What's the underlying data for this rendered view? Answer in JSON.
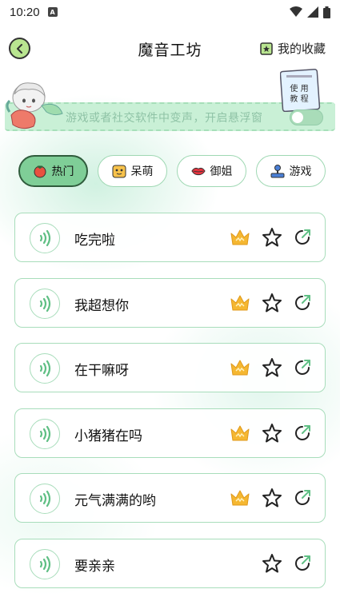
{
  "status": {
    "time": "10:20"
  },
  "header": {
    "title": "魔音工坊",
    "favorites_label": "我的收藏"
  },
  "banner": {
    "text": "游戏或者社交软件中变声，开启悬浮窗",
    "guide_label_line1": "使 用",
    "guide_label_line2": "教 程",
    "toggle_on": false
  },
  "tabs": [
    {
      "label": "热门",
      "icon": "tomato-icon",
      "active": true
    },
    {
      "label": "呆萌",
      "icon": "cute-face-icon",
      "active": false
    },
    {
      "label": "御姐",
      "icon": "lips-icon",
      "active": false
    },
    {
      "label": "游戏",
      "icon": "joystick-icon",
      "active": false
    }
  ],
  "items": [
    {
      "label": "吃完啦",
      "vip": true
    },
    {
      "label": "我超想你",
      "vip": true
    },
    {
      "label": "在干嘛呀",
      "vip": true
    },
    {
      "label": "小猪猪在吗",
      "vip": true
    },
    {
      "label": "元气满满的哟",
      "vip": true
    },
    {
      "label": "要亲亲",
      "vip": false
    }
  ],
  "colors": {
    "accent_green": "#7fce97",
    "border_green": "#a8ddbb",
    "crown_gold": "#f5b731"
  }
}
